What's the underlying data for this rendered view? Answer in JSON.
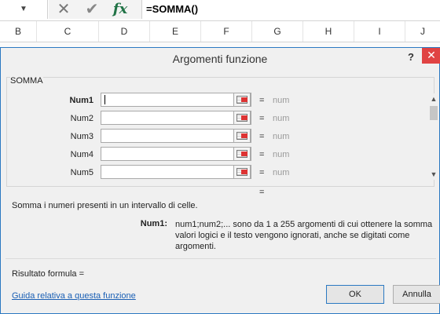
{
  "formula_bar": {
    "dropdown_arrow": "▼",
    "cancel_glyph": "✕",
    "enter_glyph": "✔",
    "fx_label": "fx",
    "formula": "=SOMMA()"
  },
  "columns": [
    "B",
    "C",
    "D",
    "E",
    "F",
    "G",
    "H",
    "I",
    "J"
  ],
  "dialog": {
    "title": "Argomenti funzione",
    "help_glyph": "?",
    "close_glyph": "✕",
    "function_name": "SOMMA",
    "args": [
      {
        "label": "Num1",
        "value": "",
        "equals": "=",
        "result": "num"
      },
      {
        "label": "Num2",
        "value": "",
        "equals": "=",
        "result": "num"
      },
      {
        "label": "Num3",
        "value": "",
        "equals": "=",
        "result": "num"
      },
      {
        "label": "Num4",
        "value": "",
        "equals": "=",
        "result": "num"
      },
      {
        "label": "Num5",
        "value": "",
        "equals": "=",
        "result": "num"
      }
    ],
    "scroll_up": "▲",
    "scroll_down": "▼",
    "result_equals": "=",
    "description": "Somma i numeri presenti in un intervallo di celle.",
    "arg_help_name": "Num1:",
    "arg_help_lines": [
      "num1;num2;... sono da 1 a 255 argomenti di cui ottenere la somma",
      "valori logici e il testo vengono ignorati, anche se digitati come",
      "argomenti."
    ],
    "result_label": "Risultato formula =",
    "help_link": "Guida relativa a questa funzione",
    "ok_label": "OK",
    "cancel_label": "Annulla"
  },
  "colors": {
    "accent": "#2b79c2",
    "close_red": "#e04343",
    "link": "#1a5fb4",
    "fx_green": "#217346"
  }
}
